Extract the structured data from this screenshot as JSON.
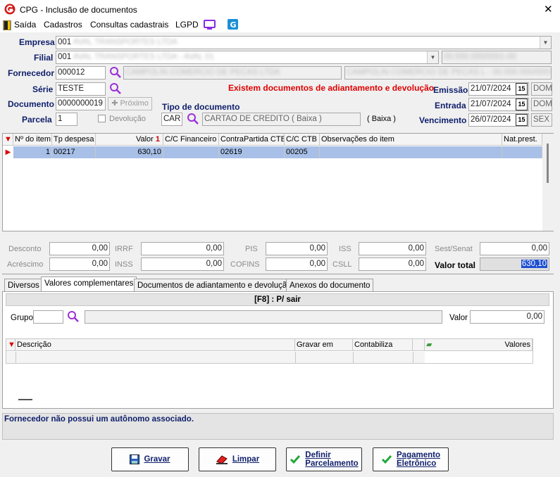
{
  "window": {
    "title": "CPG - Inclusão de documentos",
    "close": "✕"
  },
  "menu": {
    "items": [
      "Saída",
      "Cadastros",
      "Consultas cadastrais",
      "LGPD"
    ]
  },
  "header": {
    "empresa_label": "Empresa",
    "empresa_code": "001",
    "empresa_name": "AVAL TRANSPORTES LTDA",
    "filial_label": "Filial",
    "filial_code": "001",
    "filial_name": "AVAL TRANSPORTES LTDA - AVAL 01",
    "filial_extra": "00.000.000/0001-00",
    "fornecedor_label": "Fornecedor",
    "fornecedor_code": "000012",
    "fornecedor_name": "CAMPOLIN COMERCIO DE PECAS LTDA",
    "fornecedor_fantasy": "CAMPOLIN COMERCIO DE PECAS L - 00.000.000/0001",
    "serie_label": "Série",
    "serie_value": "TESTE",
    "documento_label": "Documento",
    "documento_value": "0000000019",
    "proximo_label": "Próximo",
    "parcela_label": "Parcela",
    "parcela_value": "1",
    "devolucao_label": "Devolução",
    "tipo_label": "Tipo de documento",
    "tipo_code": "CAR",
    "tipo_desc": "CARTAO DE CREDITO ( Baixa )",
    "tipo_baixa": "( Baixa )",
    "warning": "Existem documentos de adiantamento e devolução",
    "emissao_label": "Emissão",
    "emissao_date": "21/07/2024",
    "emissao_day": "DOM",
    "entrada_label": "Entrada",
    "entrada_date": "21/07/2024",
    "entrada_day": "DOM",
    "vencimento_label": "Vencimento",
    "vencimento_date": "26/07/2024",
    "vencimento_day": "SEX",
    "cal_icon": "15"
  },
  "items_grid": {
    "headers": [
      "Nº do item",
      "Tp despesa",
      "Valor",
      "C/C Financeiro",
      "ContraPartida CTB",
      "C/C CTB",
      "Observações do item",
      "Nat.prest."
    ],
    "sort_marker": "1",
    "rows": [
      {
        "item": "1",
        "tp": "00217",
        "valor": "630,10",
        "ccfin": "",
        "contra": "02619",
        "ccctb": "00205",
        "obs": "",
        "nat": ""
      }
    ]
  },
  "totals": {
    "desconto_label": "Desconto",
    "desconto": "0,00",
    "irrf_label": "IRRF",
    "irrf": "0,00",
    "pis_label": "PIS",
    "pis": "0,00",
    "iss_label": "ISS",
    "iss": "0,00",
    "sest_label": "Sest/Senat",
    "sest": "0,00",
    "acrescimo_label": "Acréscimo",
    "acrescimo": "0,00",
    "inss_label": "INSS",
    "inss": "0,00",
    "cofins_label": "COFINS",
    "cofins": "0,00",
    "csll_label": "CSLL",
    "csll": "0,00",
    "valor_total_label": "Valor total",
    "valor_total": "630,10"
  },
  "tabs": [
    "Diversos",
    "Valores complementares",
    "Documentos de adiantamento e devolução",
    "Anexos do documento"
  ],
  "panel": {
    "bar": "[F8] : P/ sair",
    "grupo_label": "Grupo",
    "grupo_value": "",
    "valor_label": "Valor",
    "valor_value": "0,00",
    "headers": [
      "Descrição",
      "Gravar em",
      "Contabiliza",
      "",
      "Valores"
    ]
  },
  "status": {
    "message": "Fornecedor não possui um autônomo associado."
  },
  "buttons": {
    "gravar": "Gravar",
    "limpar": "Limpar",
    "definir": [
      "Definir",
      "Parcelamento"
    ],
    "pagamento": [
      "Pagamento",
      "Eletrônico"
    ]
  },
  "colors": {
    "label": "#0f1f6b",
    "warning": "#e00000",
    "selected_row": "#a8c0e8",
    "accent": "#7a2bd6"
  }
}
